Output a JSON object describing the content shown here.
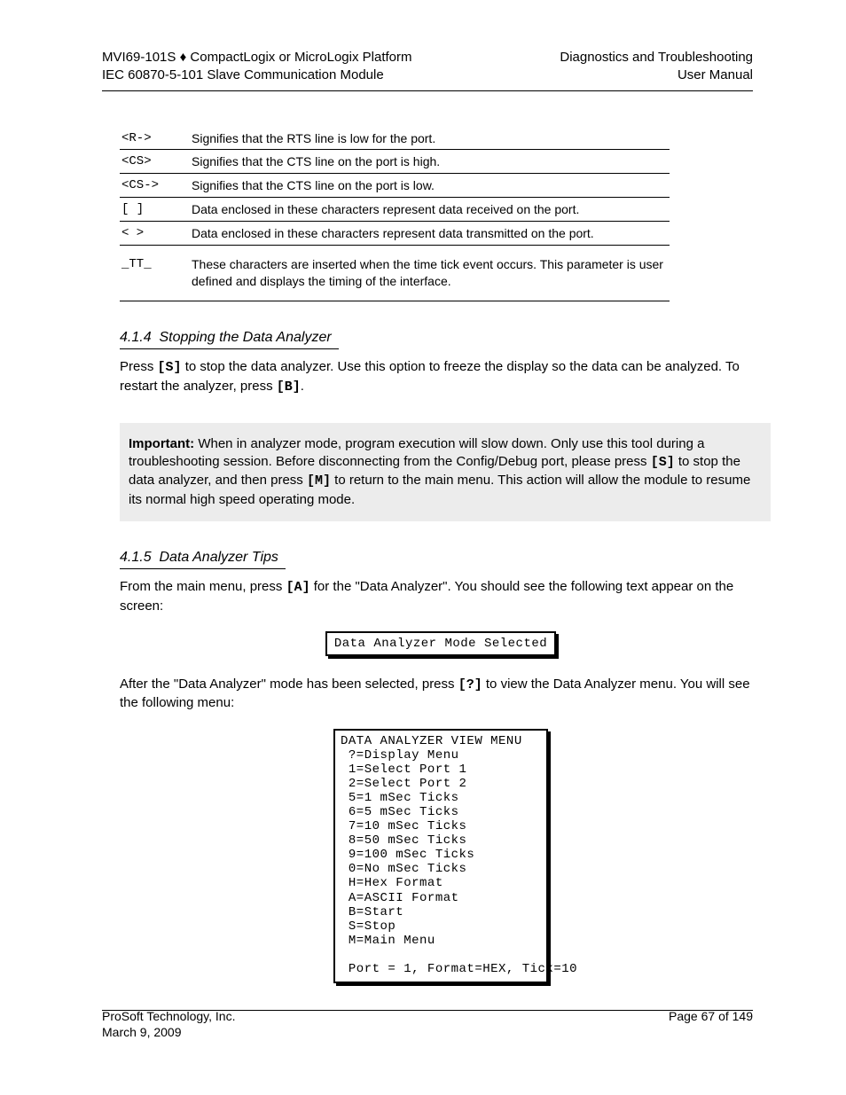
{
  "header": {
    "left_line1_a": "MVI69-101S",
    "left_line1_sep": "♦",
    "left_line1_b": "CompactLogix or MicroLogix Platform",
    "left_line2": "IEC 60870-5-101 Slave Communication Module",
    "right_line1": "Diagnostics and Troubleshooting",
    "right_line2": "User Manual"
  },
  "table_rows": [
    {
      "k": "<R->",
      "v": "Signifies that the RTS line is low for the port."
    },
    {
      "k": "<CS>",
      "v": "Signifies that the CTS line on the port is high."
    },
    {
      "k": "<CS->",
      "v": "Signifies that the CTS line on the port is low."
    },
    {
      "k": "[ ]",
      "v": "Data enclosed in these characters represent data received on the port."
    },
    {
      "k": "< >",
      "v": "Data enclosed in these characters represent data transmitted on the port."
    }
  ],
  "table_last": {
    "k": "_TT_",
    "v": "These characters are inserted when the time tick event occurs. This parameter is user defined and displays the timing of the interface."
  },
  "section_stopping": {
    "num": "4.1.4",
    "title": "Stopping the Data Analyzer",
    "body_before_key": "Press ",
    "key": "[S]",
    "body_after_key": " to stop the data analyzer. Use this option to freeze the display so the data can be analyzed. To restart the analyzer, press ",
    "key2": "[B]",
    "body_end": "."
  },
  "important": {
    "label": "Important:",
    "text1": " When in analyzer mode, program execution will slow down. Only use this tool during a troubleshooting session. Before disconnecting from the Config/Debug port, please press ",
    "key_s": "[S]",
    "text2": " to stop the data analyzer, and then press ",
    "key_m": "[M]",
    "text3": " to return to the main menu. This action will allow the module to resume its normal high speed operating mode."
  },
  "section_tips": {
    "num": "4.1.5",
    "title": "Data Analyzer Tips",
    "p1": "From the main menu, press ",
    "p1_key": "[A]",
    "p1_end": " for the \"Data Analyzer\". You should see the following text appear on the screen:",
    "term1": "Data Analyzer Mode Selected",
    "p2_before": "After the \"Data Analyzer\" mode has been selected, press ",
    "p2_key": "[?]",
    "p2_after": " to view the Data Analyzer menu. You will see the following menu:",
    "menu_lines": [
      "DATA ANALYZER VIEW MENU",
      " ?=Display Menu",
      " 1=Select Port 1",
      " 2=Select Port 2",
      " 5=1 mSec Ticks",
      " 6=5 mSec Ticks",
      " 7=10 mSec Ticks",
      " 8=50 mSec Ticks",
      " 9=100 mSec Ticks",
      " 0=No mSec Ticks",
      " H=Hex Format",
      " A=ASCII Format",
      " B=Start",
      " S=Stop",
      " M=Main Menu",
      "",
      " Port = 1, Format=HEX, Tick=10"
    ]
  },
  "footer": {
    "left_line1": "ProSoft Technology, Inc.",
    "left_line2": "March 9, 2009",
    "right_line1": "Page 67 of 149"
  }
}
